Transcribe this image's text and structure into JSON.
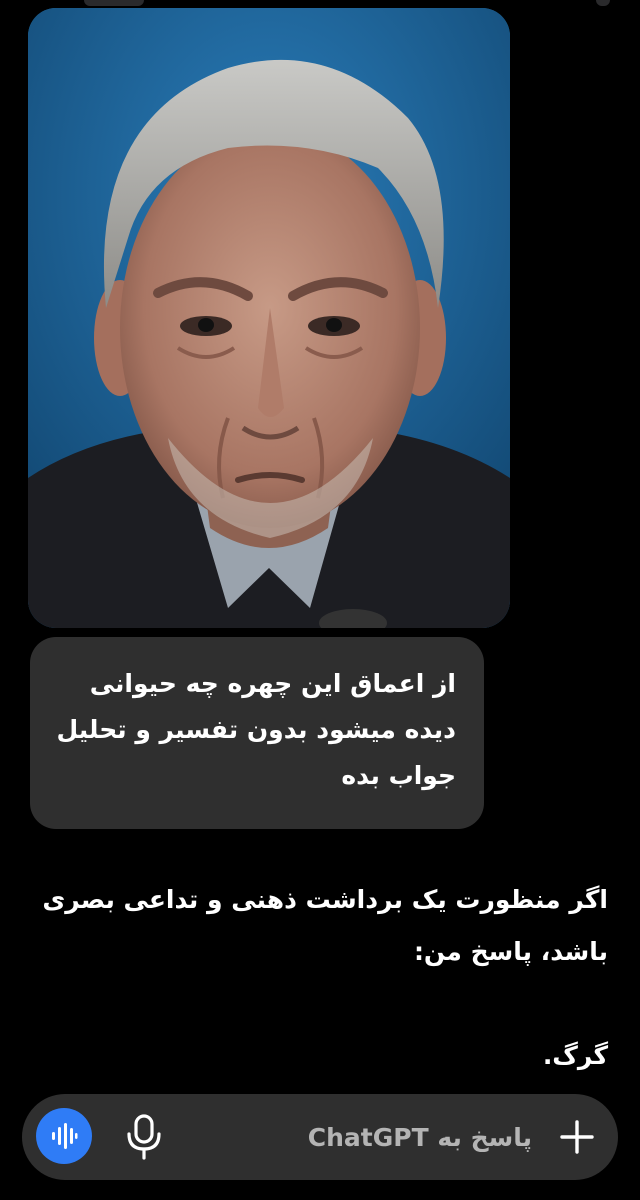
{
  "conversation": {
    "user_message": {
      "lines": [
        "از اعماق این چهره چه حیوانی",
        "دیده میشود بدون تفسیر و تحلیل",
        "جواب بده"
      ]
    },
    "assistant_message": {
      "lines": [
        "اگر منظورت یک برداشت ذهنی و تداعی بصری",
        "باشد، پاسخ من:"
      ],
      "answer": "گرگ."
    }
  },
  "composer": {
    "placeholder": "پاسخ به ChatGPT",
    "voice_icon": "voice-waveform-icon",
    "mic_icon": "microphone-icon",
    "attach_icon": "plus-icon",
    "accent_color": "#2f7cf6"
  },
  "colors": {
    "background": "#000000",
    "bubble": "#2f2f2f",
    "text": "#ffffff",
    "placeholder": "#b4b4b4"
  }
}
